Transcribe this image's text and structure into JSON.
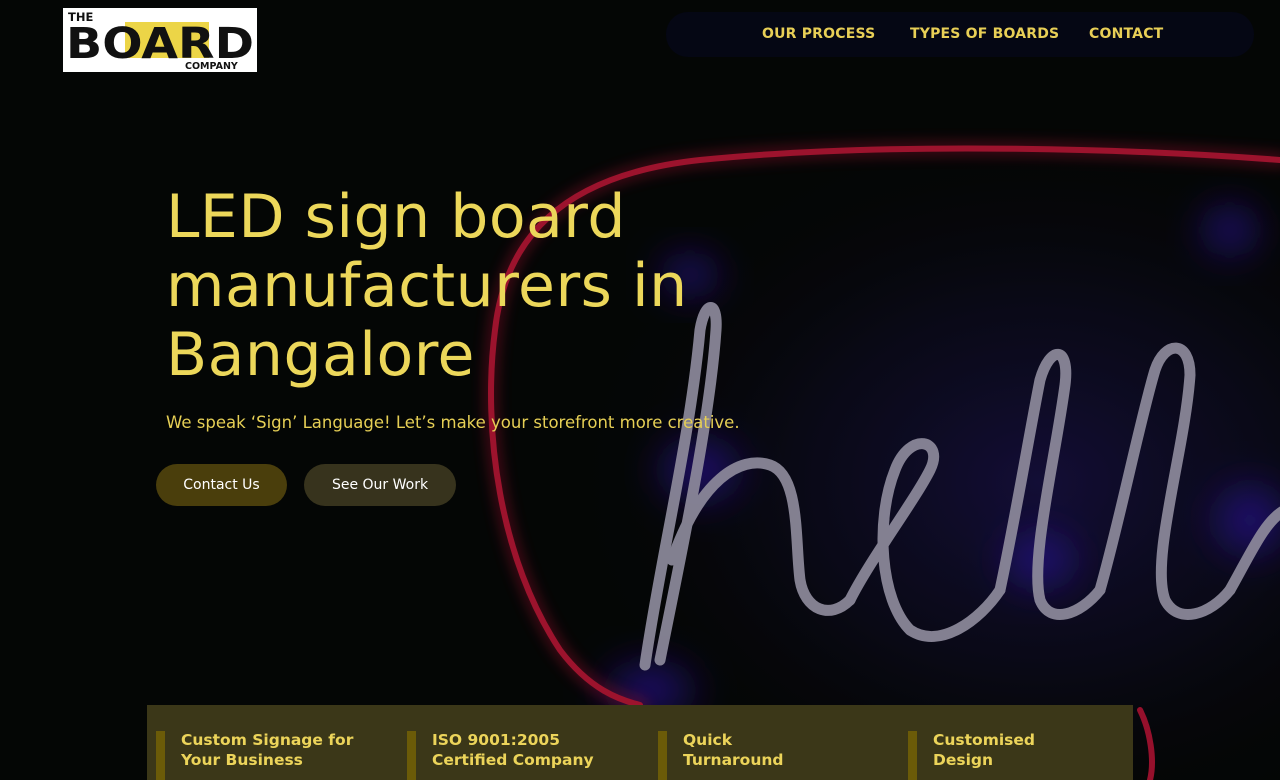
{
  "brand": {
    "logo_top": "THE",
    "logo_main": "BOARD",
    "logo_sub": "COMPANY"
  },
  "nav": {
    "items": [
      {
        "label": "OUR PROCESS"
      },
      {
        "label": "TYPES OF BOARDS"
      },
      {
        "label": "CONTACT"
      }
    ]
  },
  "hero": {
    "headline_lines": [
      "LED sign board",
      "manufacturers in",
      "Bangalore"
    ],
    "tagline": "We speak ‘Sign’ Language! Let’s make your storefront more creative.",
    "buttons": {
      "contact": "Contact Us",
      "work": "See Our Work"
    },
    "neon_word": "hello"
  },
  "features": [
    {
      "lines": [
        "Custom Signage for",
        "Your Business"
      ]
    },
    {
      "lines": [
        "ISO 9001:2005",
        "Certified Company"
      ]
    },
    {
      "lines": [
        "Quick",
        "Turnaround"
      ]
    },
    {
      "lines": [
        "Customised",
        "Design"
      ]
    }
  ],
  "colors": {
    "accent_yellow": "#ecd75a",
    "nav_bg": "#050714",
    "neon_red": "#d3163d",
    "neon_white": "#cfcbe0",
    "neon_glow": "#3b1bd8",
    "feature_bg": "#3b3718"
  }
}
